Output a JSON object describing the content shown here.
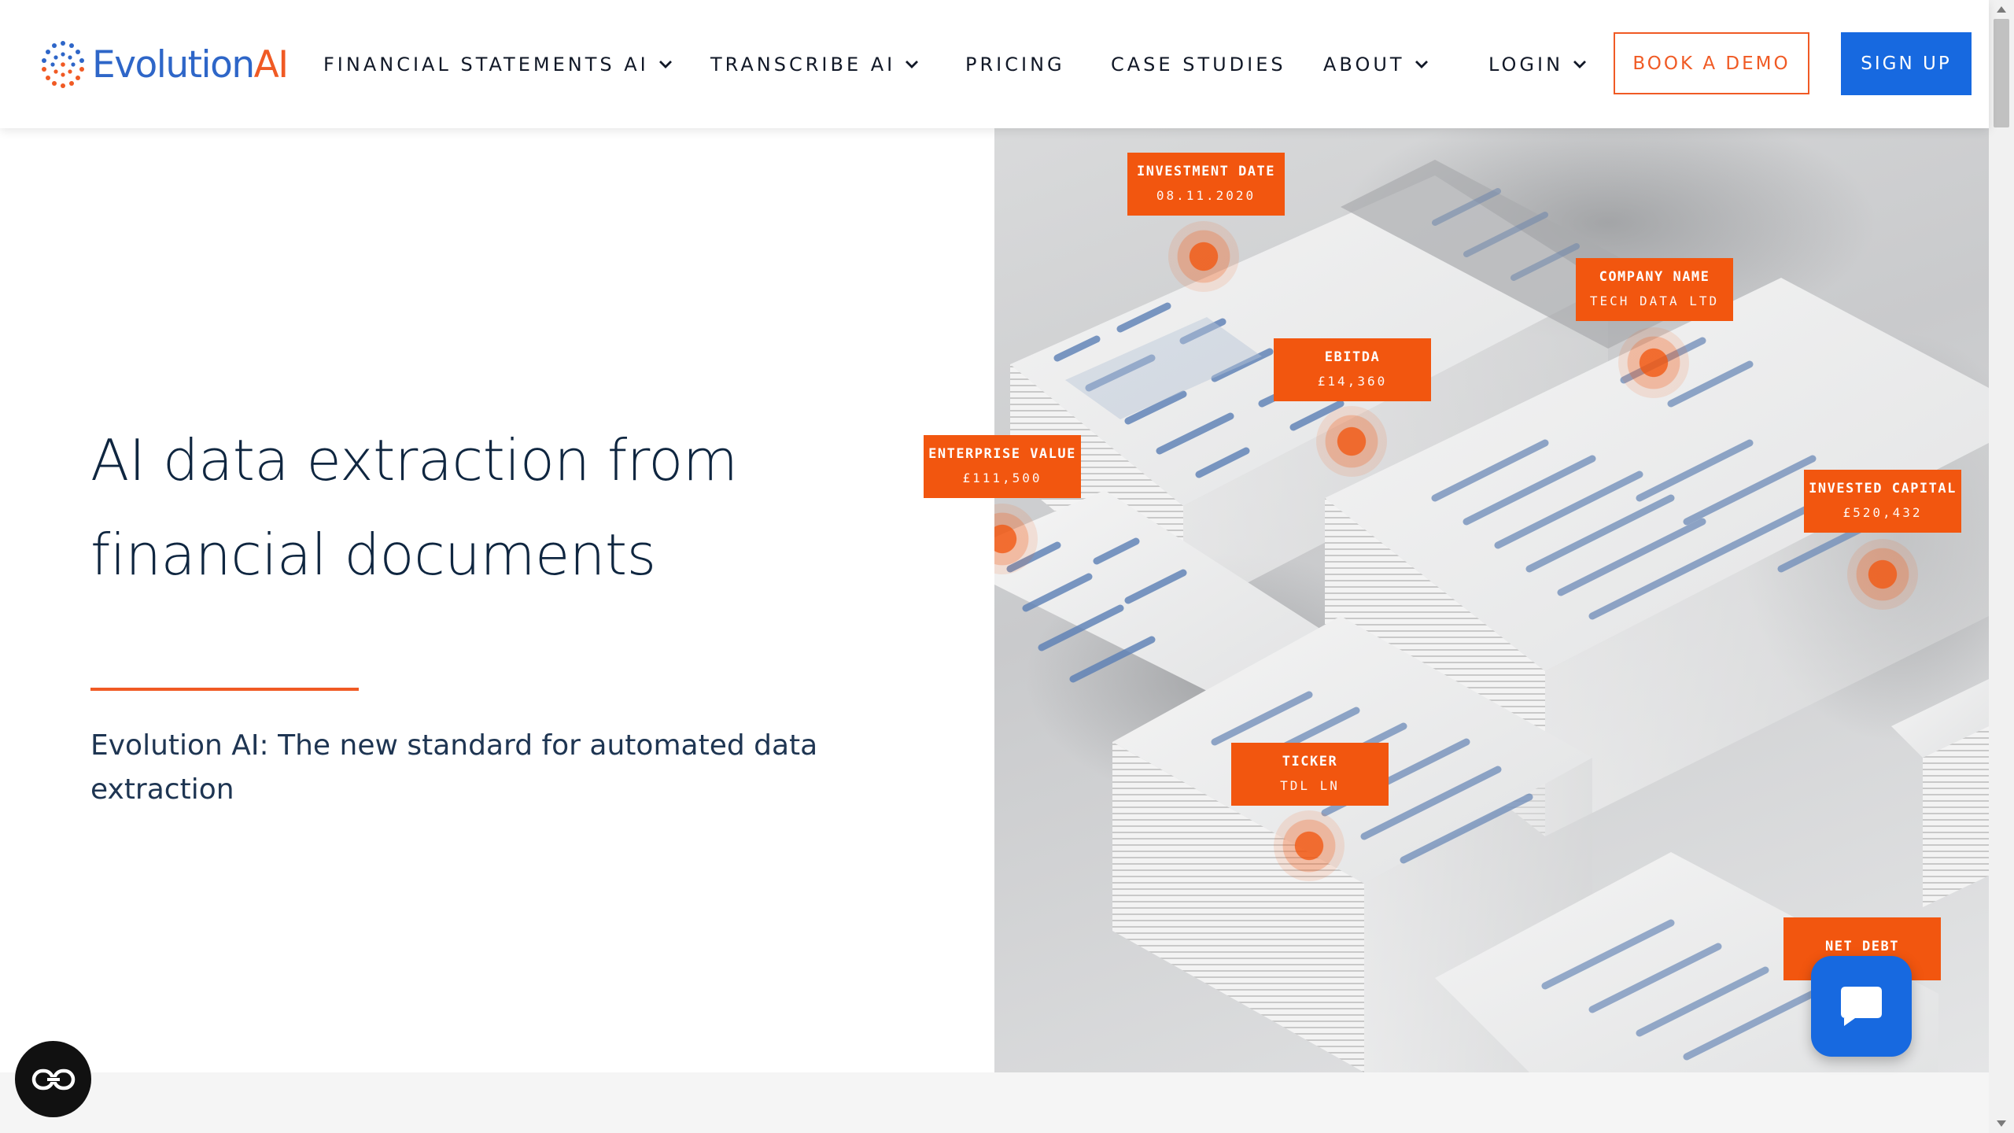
{
  "brand": {
    "name_main": "Evolution",
    "name_accent": "AI",
    "colors": {
      "blue": "#2e66c8",
      "orange": "#f05a24",
      "navy": "#0f2640",
      "cta_blue": "#1769e0"
    }
  },
  "nav": {
    "items": [
      {
        "label": "FINANCIAL STATEMENTS AI",
        "has_dropdown": true
      },
      {
        "label": "TRANSCRIBE AI",
        "has_dropdown": true
      },
      {
        "label": "PRICING",
        "has_dropdown": false
      },
      {
        "label": "CASE STUDIES",
        "has_dropdown": false
      },
      {
        "label": "ABOUT",
        "has_dropdown": true
      },
      {
        "label": "LOGIN",
        "has_dropdown": true
      }
    ],
    "book_demo": "BOOK A DEMO",
    "sign_up": "SIGN UP"
  },
  "hero": {
    "title_line1": "AI data extraction from",
    "title_line2": "financial documents",
    "subtitle": "Evolution AI: The new standard for automated data extraction"
  },
  "tags": [
    {
      "label": "INVESTMENT DATE",
      "value": "08.11.2020"
    },
    {
      "label": "COMPANY NAME",
      "value": "TECH DATA LTD"
    },
    {
      "label": "EBITDA",
      "value": "£14,360"
    },
    {
      "label": "ENTERPRISE VALUE",
      "value": "£111,500"
    },
    {
      "label": "INVESTED CAPITAL",
      "value": "£520,432"
    },
    {
      "label": "TICKER",
      "value": "TDL LN"
    },
    {
      "label": "NET DEBT",
      "value": ""
    }
  ],
  "icons": {
    "chat": "chat-bubble-icon",
    "accessibility": "accessibility-icon",
    "dropdown": "chevron-down-icon"
  }
}
